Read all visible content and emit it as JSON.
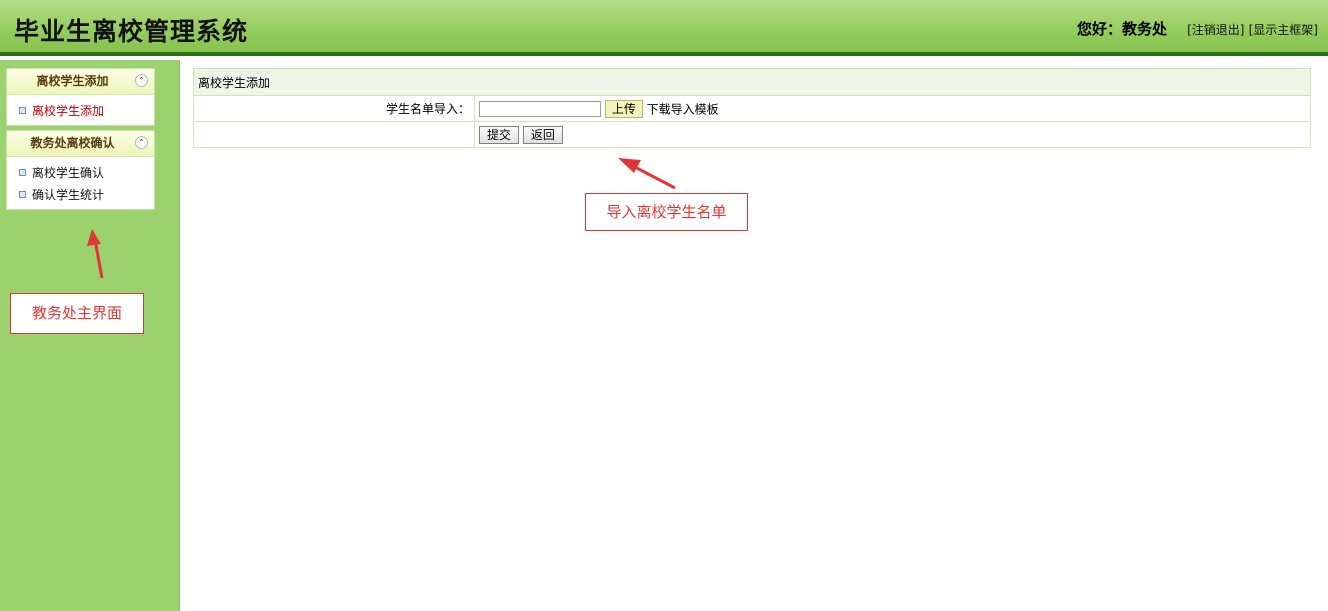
{
  "header": {
    "app_title": "毕业生离校管理系统",
    "greeting": "您好：教务处",
    "logout_link": "[注销退出]",
    "frame_link": "[显示主框架]"
  },
  "sidebar": {
    "groups": [
      {
        "title": "离校学生添加",
        "collapse_icon": "double-chevron-up-icon",
        "items": [
          {
            "label": "离校学生添加",
            "active": true
          }
        ]
      },
      {
        "title": "教务处离校确认",
        "collapse_icon": "double-chevron-up-icon",
        "items": [
          {
            "label": "离校学生确认",
            "active": false
          },
          {
            "label": "确认学生统计",
            "active": false
          }
        ]
      }
    ]
  },
  "panel": {
    "title": "离校学生添加",
    "import_label": "学生名单导入：",
    "file_value": "",
    "upload_button": "上传",
    "template_link": "下载导入模板",
    "submit_button": "提交",
    "back_button": "返回"
  },
  "annotations": {
    "sidebar_note": "教务处主界面",
    "form_note": "导入离校学生名单",
    "color": "#e23636"
  },
  "colors": {
    "header_green": "#96cd5f",
    "header_border": "#2f6f19",
    "sidebar_green": "#9bd26d",
    "active_item": "#c00000"
  }
}
